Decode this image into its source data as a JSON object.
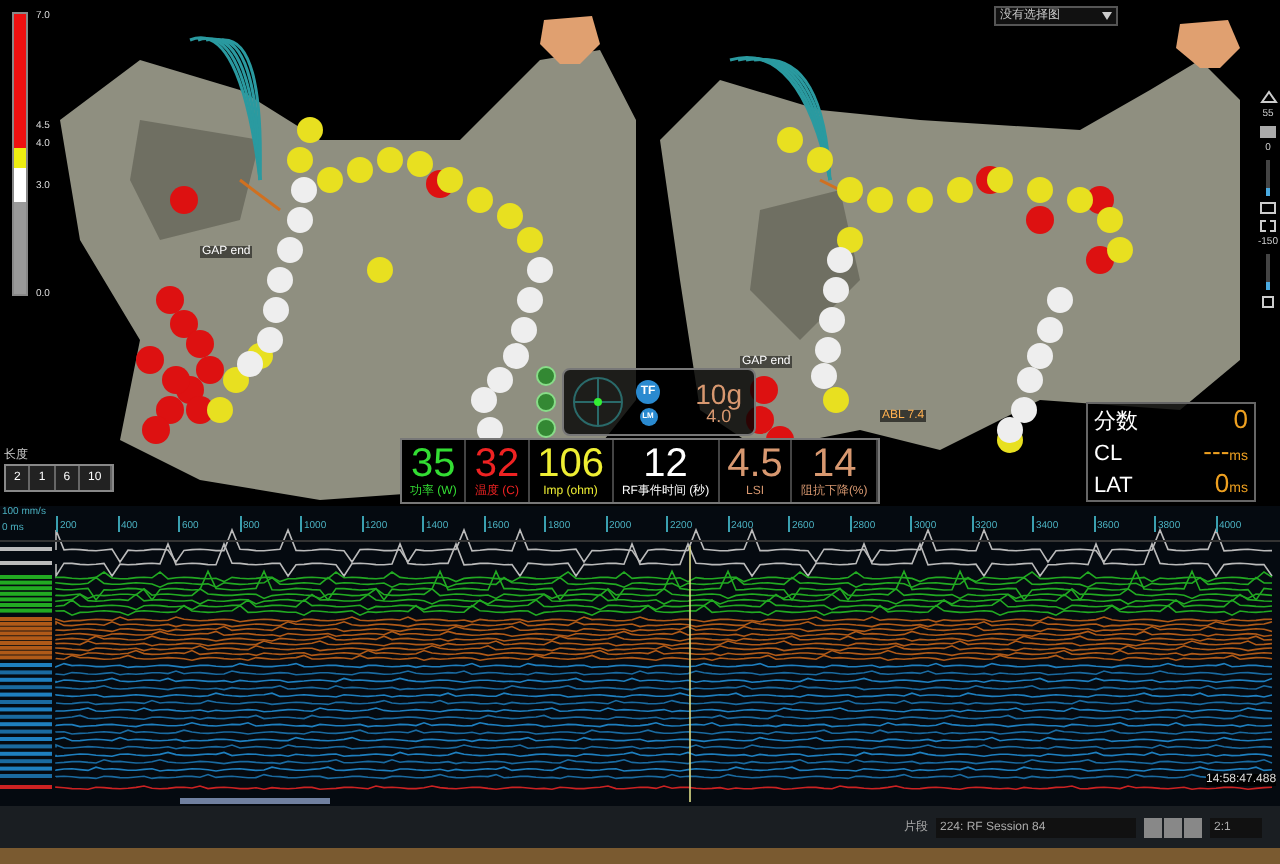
{
  "color_scale": {
    "labels": [
      "7.0",
      "4.5",
      "4.0",
      "3.0",
      "0.0"
    ]
  },
  "scale_widget": {
    "label": "长度",
    "values": [
      "2",
      "1",
      "6",
      "10"
    ]
  },
  "views": [
    {
      "labels": [
        "GAP end"
      ]
    },
    {
      "labels": [
        "GAP end",
        "ABL 7.4"
      ]
    }
  ],
  "map_selector": {
    "value": "没有选择图"
  },
  "side_toolbar": {
    "values": [
      "55",
      "0",
      "-150"
    ],
    "sliders": [
      {
        "level": 0.2
      },
      {
        "level": 0.2
      }
    ]
  },
  "catheter": {
    "badges": [
      "TF",
      "LM"
    ],
    "force": "10g",
    "force_sub": "4.0"
  },
  "metrics": [
    {
      "value": "35",
      "label": "功率 (W)",
      "color": "#33dd33"
    },
    {
      "value": "32",
      "label": "温度 (C)",
      "color": "#ee2222"
    },
    {
      "value": "106",
      "label": "Imp (ohm)",
      "color": "#eeee33"
    },
    {
      "value": "12",
      "label": "RF事件时间 (秒)",
      "color": "#ffffff"
    },
    {
      "value": "4.5",
      "label": "LSI",
      "color": "#d89870"
    },
    {
      "value": "14",
      "label": "阻抗下降(%)",
      "color": "#d89870"
    }
  ],
  "stats": [
    {
      "label": "分数",
      "value": "0"
    },
    {
      "label": "CL",
      "value": "---",
      "unit": "ms"
    },
    {
      "label": "LAT",
      "value": "0",
      "unit": "ms"
    }
  ],
  "timeline": {
    "speed": "100 mm/s",
    "offset": "0 ms",
    "ticks": [
      "200",
      "400",
      "600",
      "800",
      "1000",
      "1200",
      "1400",
      "1600",
      "1800",
      "2000",
      "2200",
      "2400",
      "2600",
      "2800",
      "3000",
      "3200",
      "3400",
      "3600",
      "3800",
      "4000"
    ],
    "timestamp": "14:58:47.488"
  },
  "playback": {
    "label": "片段",
    "session": "224: RF Session 84",
    "ratio": "2:1"
  }
}
